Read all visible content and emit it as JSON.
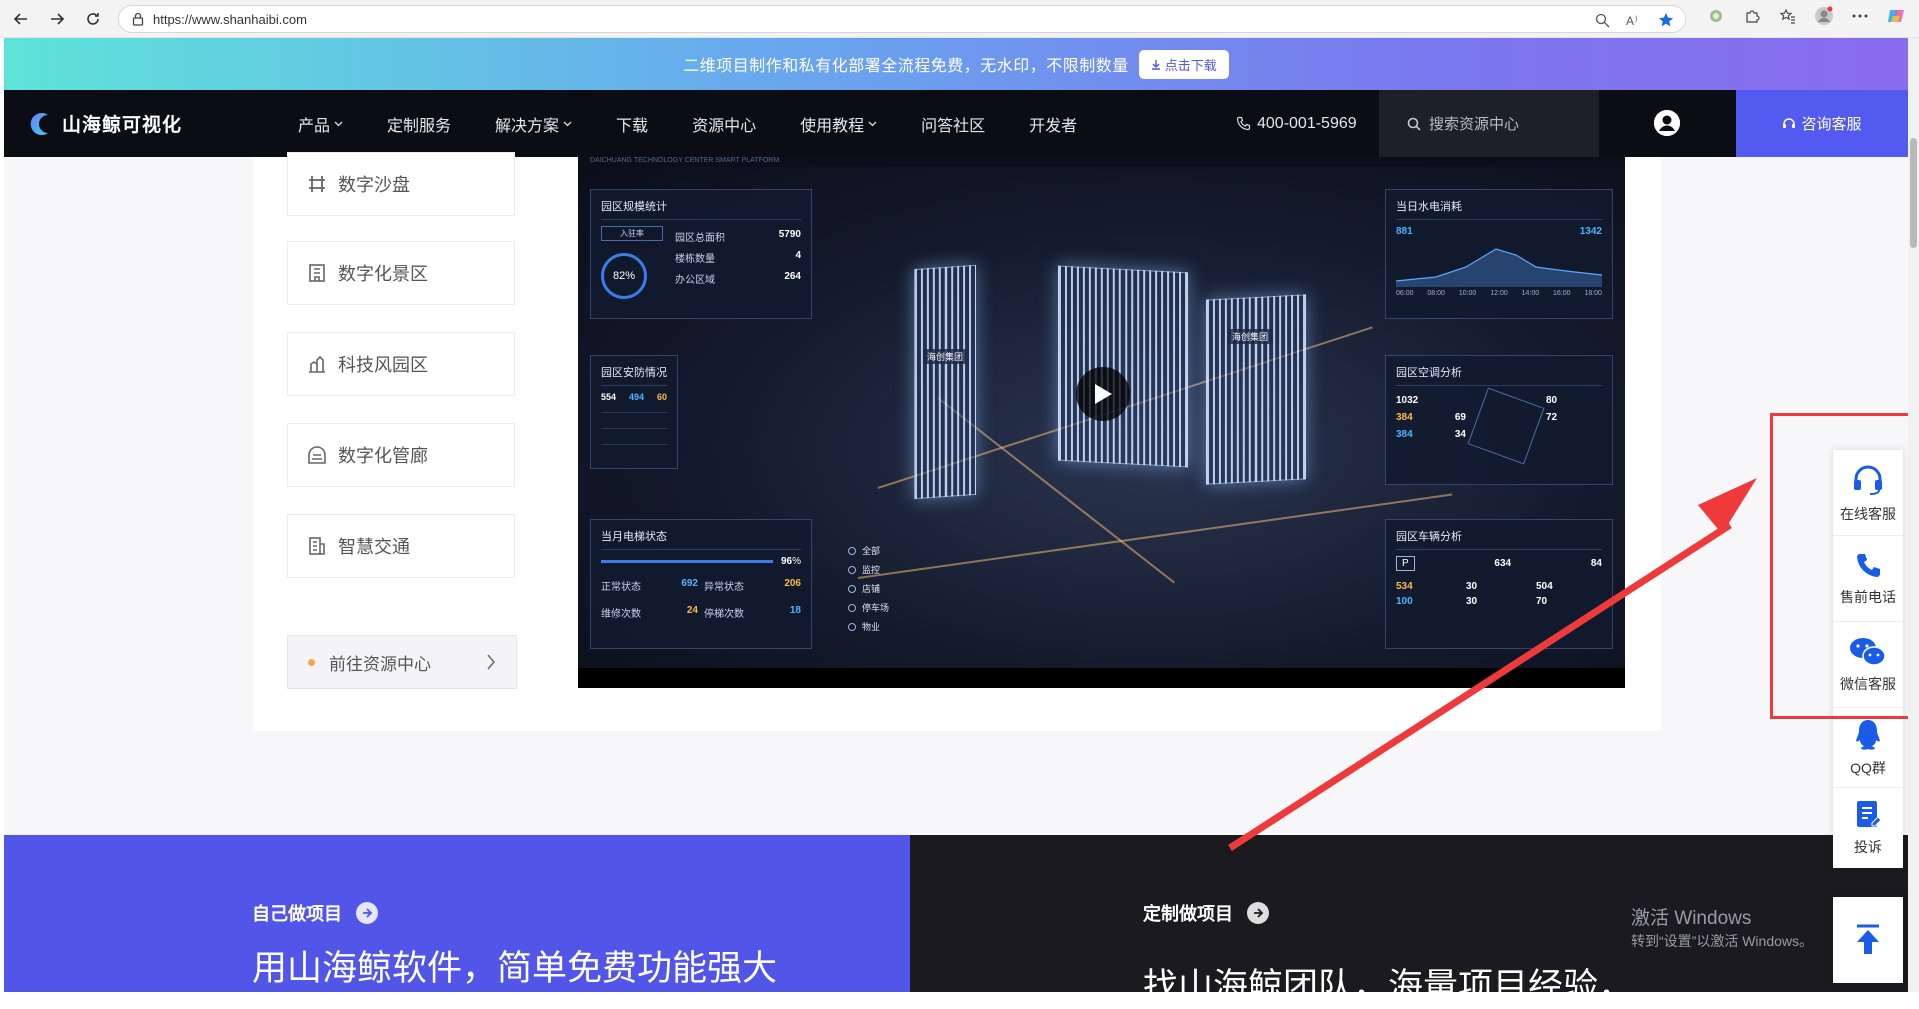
{
  "browser": {
    "url": "https://www.shanhaibi.com"
  },
  "promo": {
    "text": "二维项目制作和私有化部署全流程免费，无水印，不限制数量",
    "button": "点击下载"
  },
  "nav": {
    "logo_text": "山海鲸可视化",
    "items": [
      {
        "label": "产品",
        "dropdown": true
      },
      {
        "label": "定制服务",
        "dropdown": false
      },
      {
        "label": "解决方案",
        "dropdown": true
      },
      {
        "label": "下载",
        "dropdown": false
      },
      {
        "label": "资源中心",
        "dropdown": false
      },
      {
        "label": "使用教程",
        "dropdown": true
      },
      {
        "label": "问答社区",
        "dropdown": false
      },
      {
        "label": "开发者",
        "dropdown": false
      }
    ],
    "phone": "400-001-5969",
    "search_placeholder": "搜索资源中心",
    "consult": "咨询客服"
  },
  "categories": [
    {
      "label": "数字沙盘",
      "icon": "sandbox-icon"
    },
    {
      "label": "数字化景区",
      "icon": "scenic-icon"
    },
    {
      "label": "科技风园区",
      "icon": "park-icon"
    },
    {
      "label": "数字化管廊",
      "icon": "pipe-gallery-icon"
    },
    {
      "label": "智慧交通",
      "icon": "traffic-icon"
    }
  ],
  "goto_resource": "前往资源中心",
  "video": {
    "header": "DAICHUANG TECHNOLOGY CENTER SMART PLATFORM",
    "panels": {
      "scale": {
        "title": "园区规模统计",
        "rate_label": "入驻率",
        "rate_value": "82",
        "rows": [
          {
            "label": "园区总面积",
            "value": "5790"
          },
          {
            "label": "楼栋数量",
            "value": "4"
          },
          {
            "label": "办公区域",
            "value": "264"
          }
        ]
      },
      "security": {
        "title": "园区安防情况",
        "monitor_total": "554",
        "normal": "494",
        "fault": "60"
      },
      "elevator": {
        "title": "当月电梯状态",
        "safe_index": "96",
        "rows": [
          {
            "label": "正常状态",
            "value": "692"
          },
          {
            "label": "异常状态",
            "value": "206"
          },
          {
            "label": "维修次数",
            "value": "24"
          },
          {
            "label": "停梯次数",
            "value": "18"
          }
        ]
      },
      "water": {
        "title": "当日水电消耗",
        "water_value": "881",
        "power_value": "1342",
        "times": [
          "06:00",
          "08:00",
          "10:00",
          "12:00",
          "14:00",
          "16:00",
          "18:00"
        ]
      },
      "aircon": {
        "title": "园区空调分析",
        "total": "1032",
        "on": "384",
        "comfort": "69",
        "device": "80",
        "fault": "384",
        "repair": "34",
        "energy": "72"
      },
      "vehicle": {
        "title": "园区车辆分析",
        "total": "634",
        "rate": "84",
        "used": "534",
        "ground_used": "30",
        "underground_used": "504",
        "free": "100",
        "ground_free": "30",
        "underground_free": "70"
      }
    },
    "buildings": [
      "海创集团",
      "海创集团"
    ],
    "legend": [
      "全部",
      "监控",
      "店铺",
      "停车场",
      "物业"
    ]
  },
  "bottom": {
    "left_label": "自己做项目",
    "left_title": "用山海鲸软件，简单免费功能强大",
    "right_label": "定制做项目",
    "right_title": "找山海鲸团队，海量项目经验，"
  },
  "side_service": [
    {
      "label": "在线客服",
      "icon": "headset-icon"
    },
    {
      "label": "售前电话",
      "icon": "phone-icon"
    },
    {
      "label": "微信客服",
      "icon": "wechat-icon"
    },
    {
      "label": "QQ群",
      "icon": "qq-icon"
    },
    {
      "label": "投诉",
      "icon": "complaint-icon"
    }
  ],
  "watermark": {
    "title": "激活 Windows",
    "sub": "转到“设置”以激活 Windows。"
  },
  "colors": {
    "accent": "#535af0",
    "annotation_red": "#ee3a3a",
    "service_blue": "#1a5ce8"
  }
}
